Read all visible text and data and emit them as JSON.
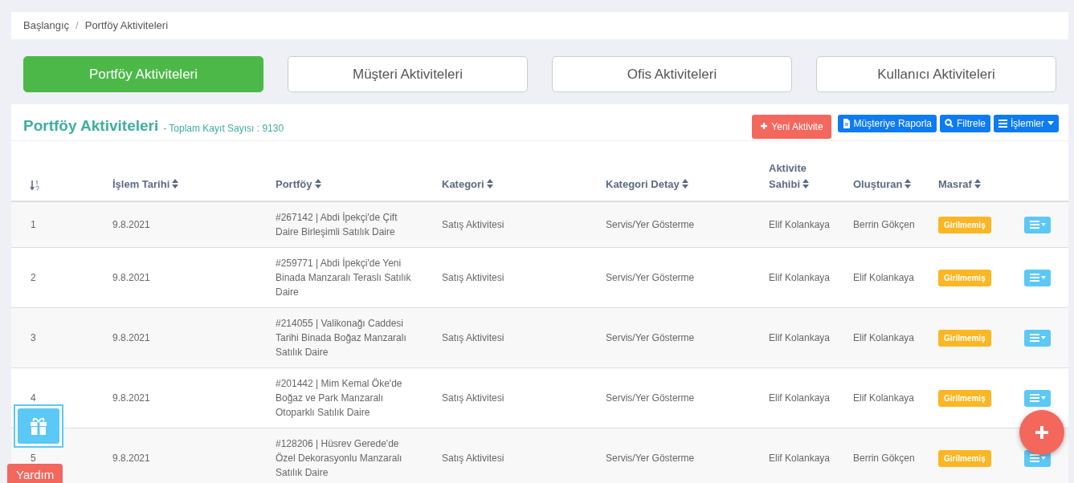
{
  "breadcrumb": [
    "Başlangıç",
    "Portföy Aktiviteleri"
  ],
  "breadcrumb_separator": "/",
  "tabs": [
    {
      "label": "Portföy Aktiviteleri",
      "selected": true
    },
    {
      "label": "Müşteri Aktiviteleri",
      "selected": false
    },
    {
      "label": "Ofis Aktiviteleri",
      "selected": false
    },
    {
      "label": "Kullanıcı Aktiviteleri",
      "selected": false
    }
  ],
  "panel": {
    "title": "Portföy Aktiviteleri",
    "subtitle": "- Toplam Kayıt Sayısı : 9130",
    "buttons": [
      {
        "kind": "new",
        "label": "Yeni Aktivite"
      },
      {
        "kind": "report",
        "label": "Müşteriye Raporla"
      },
      {
        "kind": "filter",
        "label": "Filtrele"
      },
      {
        "kind": "actions",
        "label": "İşlemler"
      }
    ]
  },
  "table": {
    "columns": [
      "İşlem Tarihi",
      "Portföy",
      "Kategori",
      "Kategori Detay",
      "Aktivite Sahibi",
      "Oluşturan",
      "Masraf"
    ],
    "rows": [
      {
        "no": "1",
        "date": "9.8.2021",
        "portfolio": "#267142 | Abdi İpekçi'de Çift Daire Birleşimli Satılık Daire",
        "category": "Satış Aktivitesi",
        "detail": "Servis/Yer Gösterme",
        "owner": "Elif Kolankaya",
        "creator": "Berrin Gökçen",
        "expense": "Girilmemiş"
      },
      {
        "no": "2",
        "date": "9.8.2021",
        "portfolio": "#259771 | Abdi İpekçi'de Yeni Binada Manzaralı Teraslı Satılık Daire",
        "category": "Satış Aktivitesi",
        "detail": "Servis/Yer Gösterme",
        "owner": "Elif Kolankaya",
        "creator": "Elif Kolankaya",
        "expense": "Girilmemiş"
      },
      {
        "no": "3",
        "date": "9.8.2021",
        "portfolio": "#214055 | Valikonağı Caddesi Tarihi Binada Boğaz Manzaralı Satılık Daire",
        "category": "Satış Aktivitesi",
        "detail": "Servis/Yer Gösterme",
        "owner": "Elif Kolankaya",
        "creator": "Elif Kolankaya",
        "expense": "Girilmemiş"
      },
      {
        "no": "4",
        "date": "9.8.2021",
        "portfolio": "#201442 | Mim Kemal Öke'de Boğaz ve Park Manzaralı Otoparklı Satılık Daire",
        "category": "Satış Aktivitesi",
        "detail": "Servis/Yer Gösterme",
        "owner": "Elif Kolankaya",
        "creator": "Elif Kolankaya",
        "expense": "Girilmemiş"
      },
      {
        "no": "5",
        "date": "9.8.2021",
        "portfolio": "#128206 | Hüsrev Gerede'de Özel Dekorasyonlu Manzaralı Satılık Daire",
        "category": "Satış Aktivitesi",
        "detail": "Servis/Yer Gösterme",
        "owner": "Elif Kolankaya",
        "creator": "Berrin Gökçen",
        "expense": "Girilmemiş"
      }
    ]
  },
  "help_button": "Yardım"
}
